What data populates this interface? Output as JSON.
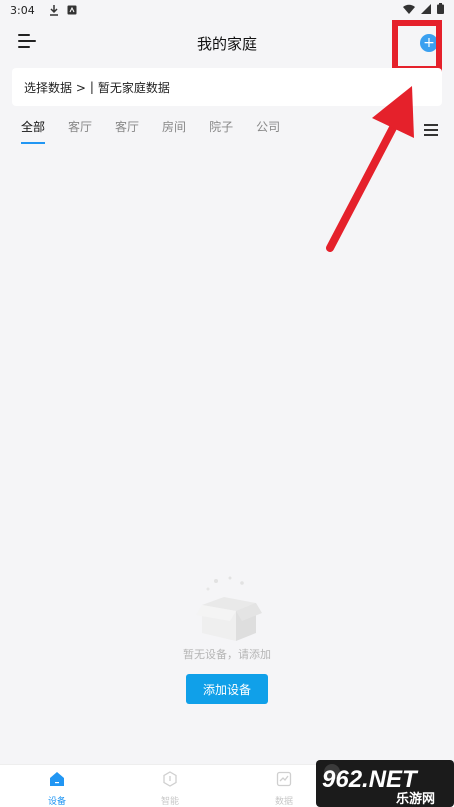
{
  "status_bar": {
    "time": "3:04"
  },
  "header": {
    "title": "我的家庭",
    "add_icon_text": "+"
  },
  "data_card": {
    "prefix": "选择数据 >",
    "separator": "|",
    "value": "暂无家庭数据"
  },
  "tabs": [
    {
      "label": "全部",
      "active": true
    },
    {
      "label": "客厅"
    },
    {
      "label": "客厅"
    },
    {
      "label": "房间"
    },
    {
      "label": "院子"
    },
    {
      "label": "公司"
    }
  ],
  "empty_state": {
    "message": "暂无设备，请添加",
    "button_label": "添加设备"
  },
  "bottom_nav": [
    {
      "label": "设备",
      "icon": "home-icon",
      "active": true
    },
    {
      "label": "智能",
      "icon": "smart-icon"
    },
    {
      "label": "数据",
      "icon": "chart-icon"
    }
  ],
  "watermark": {
    "text": "962.NET",
    "subtext": "乐游网"
  },
  "colors": {
    "accent": "#2196f3",
    "add_button": "#3aa0f0",
    "primary_button": "#10a0e9",
    "highlight": "#e5212b"
  }
}
